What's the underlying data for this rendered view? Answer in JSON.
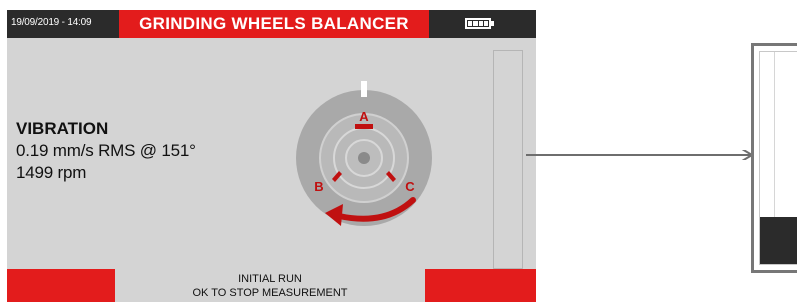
{
  "header": {
    "datetime": "19/09/2019 - 14:09",
    "title": "GRINDING WHEELS BALANCER",
    "battery_icon": "battery-full-icon"
  },
  "readout": {
    "label": "VIBRATION",
    "vibration": "0.19 mm/s RMS @ 151°",
    "speed": "1499 rpm"
  },
  "wheel": {
    "marker_a": "A",
    "marker_b": "B",
    "marker_c": "C",
    "rotation_icon": "rotation-arrow-icon"
  },
  "status": {
    "line1": "INITIAL RUN",
    "line2": "OK TO STOP MEASUREMENT"
  },
  "gauge": {
    "level": 0.22
  },
  "colors": {
    "accent": "#e31c1c",
    "dark": "#2b2b2b",
    "screen_bg": "#d4d4d4"
  }
}
